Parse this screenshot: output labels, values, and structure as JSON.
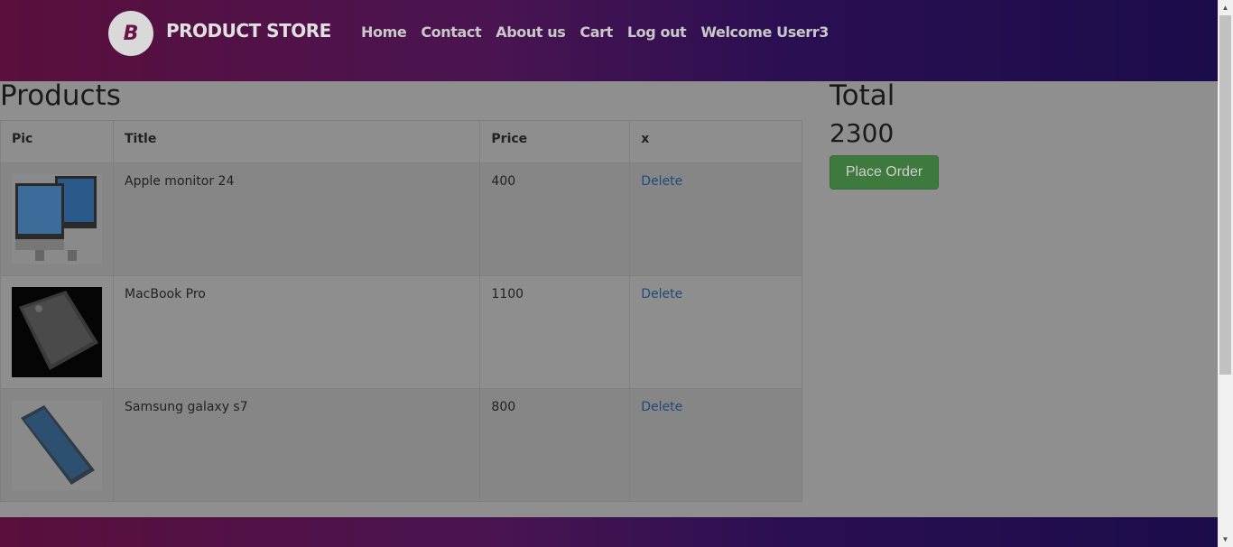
{
  "navbar": {
    "logo_glyph": "B",
    "brand": "PRODUCT STORE",
    "links": [
      "Home",
      "Contact",
      "About us",
      "Cart",
      "Log out",
      "Welcome Userr3"
    ]
  },
  "products": {
    "title": "Products",
    "headers": [
      "Pic",
      "Title",
      "Price",
      "x"
    ],
    "rows": [
      {
        "title": "Apple monitor 24",
        "price": "400",
        "action": "Delete",
        "image": "apple-monitor-image"
      },
      {
        "title": "MacBook Pro",
        "price": "1100",
        "action": "Delete",
        "image": "macbook-pro-image"
      },
      {
        "title": "Samsung galaxy s7",
        "price": "800",
        "action": "Delete",
        "image": "samsung-galaxy-image"
      }
    ]
  },
  "summary": {
    "label": "Total",
    "value": "2300",
    "button": "Place Order"
  },
  "colors": {
    "brand_start": "#5a0f3c",
    "brand_end": "#1b0c4a",
    "button": "#3e7a3e",
    "link": "#1f4a7a"
  }
}
